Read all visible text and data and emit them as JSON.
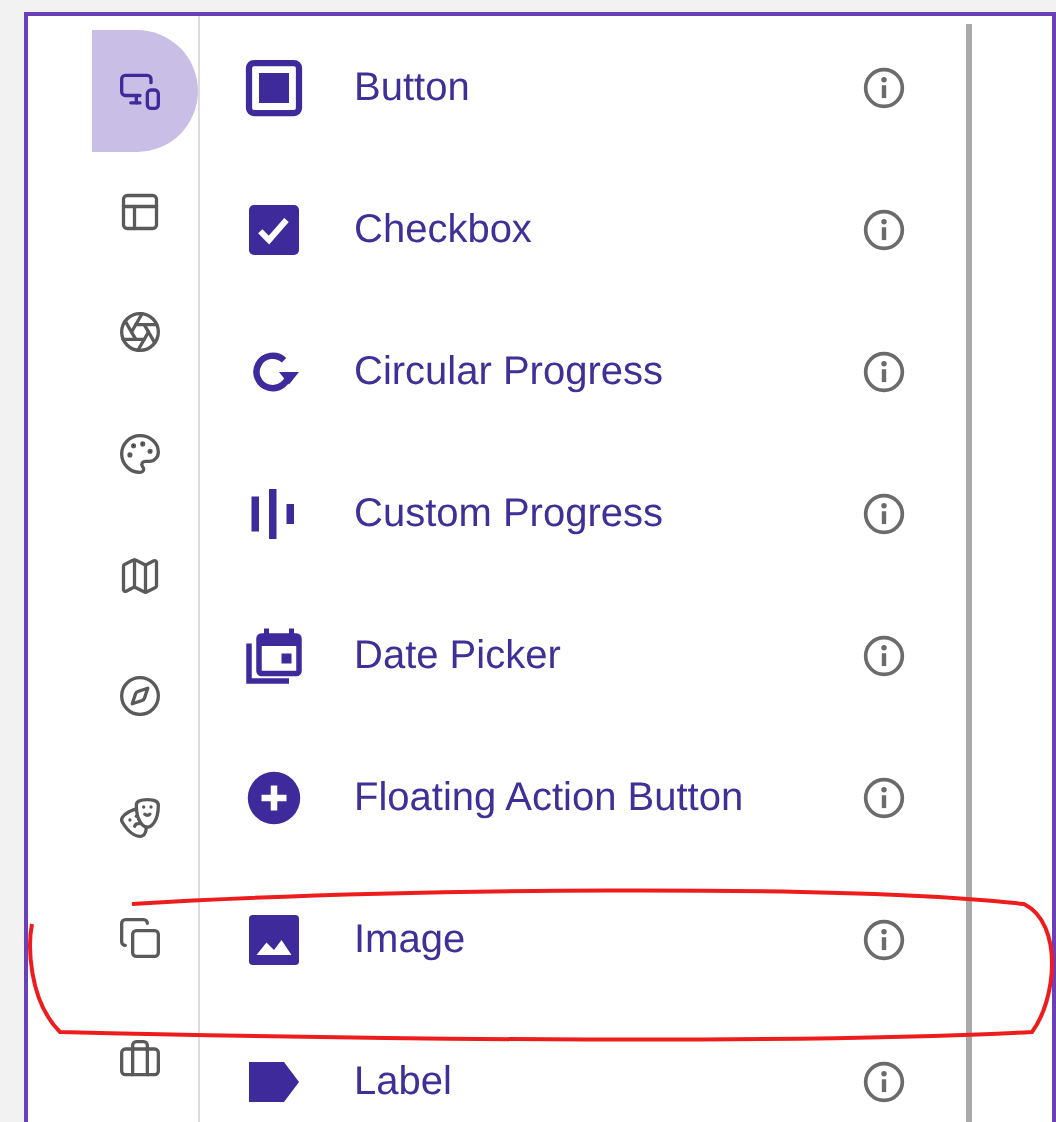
{
  "sidebar": {
    "items": [
      {
        "selected": true
      },
      {
        "selected": false
      },
      {
        "selected": false
      },
      {
        "selected": false
      },
      {
        "selected": false
      },
      {
        "selected": false
      },
      {
        "selected": false
      },
      {
        "selected": false
      },
      {
        "selected": false
      }
    ]
  },
  "components": [
    {
      "label": "Button"
    },
    {
      "label": "Checkbox"
    },
    {
      "label": "Circular Progress"
    },
    {
      "label": "Custom Progress"
    },
    {
      "label": "Date Picker"
    },
    {
      "label": "Floating Action Button"
    },
    {
      "label": "Image"
    },
    {
      "label": "Label"
    }
  ]
}
